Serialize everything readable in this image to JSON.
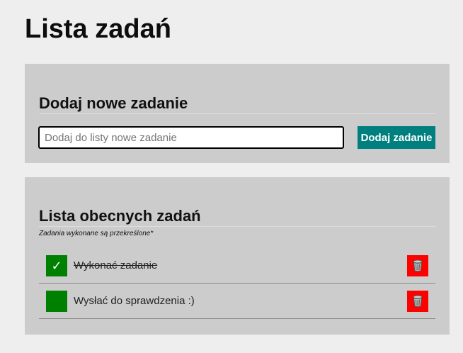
{
  "page": {
    "title": "Lista zadań"
  },
  "add_panel": {
    "heading": "Dodaj nowe zadanie",
    "input_placeholder": "Dodaj do listy nowe zadanie",
    "input_value": "",
    "button_label": "Dodaj zadanie"
  },
  "list_panel": {
    "heading": "Lista obecnych zadań",
    "hint": "Zadania wykonane są przekreślone*",
    "tasks": [
      {
        "text": "Wykonać zadanie",
        "done": true,
        "check_symbol": "✓",
        "delete_icon": "trash-icon"
      },
      {
        "text": "Wysłać do sprawdzenia :)",
        "done": false,
        "check_symbol": "",
        "delete_icon": "trash-icon"
      }
    ]
  },
  "colors": {
    "background": "#eeeeee",
    "panel": "#cccccc",
    "accent_button": "#007f7f",
    "checkbox": "#008000",
    "delete_button": "#ff0000"
  }
}
